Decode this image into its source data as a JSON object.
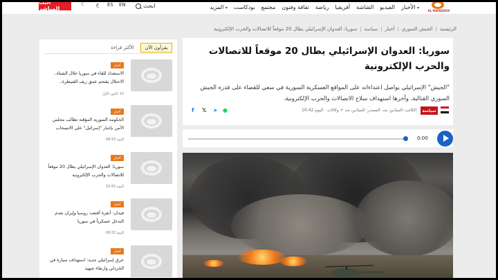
{
  "header": {
    "logo_text": "AL MAYADEEN",
    "nav": [
      "الأخبار",
      "الفيديو",
      "الشاشة",
      "أفريقيا",
      "رياضة",
      "ثقافة وفنون",
      "مجتمع",
      "بودكاست",
      "المزيد"
    ],
    "search_label": "ابحث",
    "langs": [
      "EN",
      "ES",
      "ع"
    ],
    "live_label": "البث المباشر"
  },
  "breadcrumb": [
    "الرئيسية",
    "الجيش السوري",
    "أخبار",
    "سياسة",
    "سوريا: العدوان الإسرائيلي يطال 20 موقعاً للاتصالات والحرب الإلكترونية"
  ],
  "article": {
    "headline": "سوريا: العدوان الإسرائيلي يطال 20 موقعاً للاتصالات والحرب الإلكترونية",
    "summary": "\"الجيش\" الإسرائيلي يواصل اعتداءاته على المواقع العسكرية السورية في سعي للقضاء على قدرة الجيش السوري القتالية، وآخرها استهداف سلاح الاتصالات والحرب الإلكترونية.",
    "section": "سياسة",
    "author": "الكاتب: الميادين نت",
    "source": "المصدر: الميادين نت + وكالات",
    "time": "اليوم 10:42"
  },
  "audio": {
    "time": "0:00",
    "progress": 0.99
  },
  "sidebar": {
    "tab_active": "يقرأون الآن",
    "tab_inactive": "الأكثر قراءة",
    "items": [
      {
        "badge": "أخبار",
        "title": "الاستعداد للقاء في سوريا خلال الشتاء.. الاحتلال يقتحم عمق ريف القنيطرة..",
        "date": "13 كانون الأول"
      },
      {
        "badge": "أخبار",
        "title": "الحكومة السورية المؤقتة تطالب مجلس الأمن بإجبار \"إسرائيل\" على الانسحاب",
        "date": "اليوم 09:10"
      },
      {
        "badge": "أخبار",
        "title": "سوريا: العدوان الإسرائيلي يطال 20 موقعاً للاتصالات والحرب الإلكترونية",
        "date": "اليوم 10:42"
      },
      {
        "badge": "أخبار",
        "title": "فيدان: أنقرة أقنعت روسيا وإيران بعدم التدخل عسكرياً في سوريا",
        "date": "اليوم 09:32"
      },
      {
        "badge": "أخبار",
        "title": "خرق إسرائيلي جديد: استهداف سيارة في الخردلي وارتقاء شهيد",
        "date": ""
      }
    ]
  },
  "colors": {
    "accent_red": "#e31e24",
    "play_blue": "#1b62c5",
    "badge_orange": "#e8781b"
  }
}
